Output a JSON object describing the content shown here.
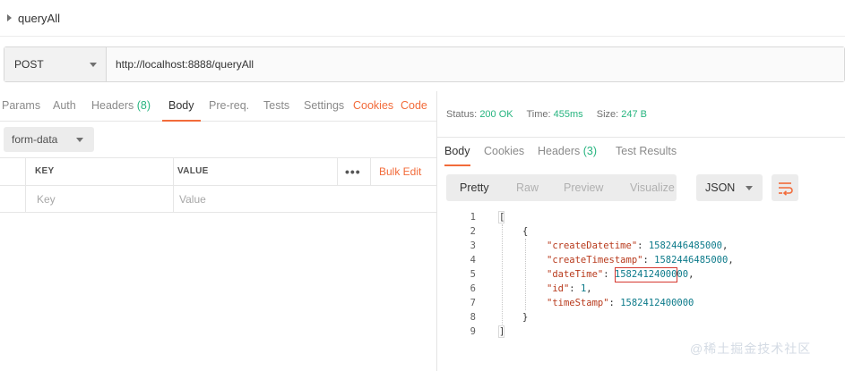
{
  "request": {
    "name": "queryAll",
    "method": "POST",
    "url": "http://localhost:8888/queryAll"
  },
  "request_tabs": {
    "params": "Params",
    "auth": "Auth",
    "headers": "Headers",
    "headers_count": "(8)",
    "body": "Body",
    "prereq": "Pre-req.",
    "tests": "Tests",
    "settings": "Settings",
    "cookies": "Cookies",
    "code": "Code"
  },
  "body_mode": "form-data",
  "table": {
    "key_header": "KEY",
    "value_header": "VALUE",
    "more": "•••",
    "bulk_edit": "Bulk Edit",
    "key_placeholder": "Key",
    "value_placeholder": "Value"
  },
  "response_status": {
    "status_label": "Status:",
    "status_value": "200 OK",
    "time_label": "Time:",
    "time_value": "455ms",
    "size_label": "Size:",
    "size_value": "247 B"
  },
  "response_tabs": {
    "body": "Body",
    "cookies": "Cookies",
    "headers": "Headers",
    "headers_count": "(3)",
    "test_results": "Test Results"
  },
  "view_modes": {
    "pretty": "Pretty",
    "raw": "Raw",
    "preview": "Preview",
    "visualize": "Visualize"
  },
  "format": "JSON",
  "code_lines": {
    "n1": "1",
    "n2": "2",
    "n3": "3",
    "n4": "4",
    "n5": "5",
    "n6": "6",
    "n7": "7",
    "n8": "8",
    "n9": "9",
    "l1": "[",
    "l2": "{",
    "l3_key": "\"createDatetime\"",
    "l3_val": "1582446485000",
    "l4_key": "\"createTimestamp\"",
    "l4_val": "1582446485000",
    "l5_key": "\"dateTime\"",
    "l5_val": "1582412400000",
    "l6_key": "\"id\"",
    "l6_val": "1",
    "l7_key": "\"timeStamp\"",
    "l7_val": "1582412400000",
    "l8": "}",
    "l9": "]"
  },
  "watermark": "@稀土掘金技术社区"
}
